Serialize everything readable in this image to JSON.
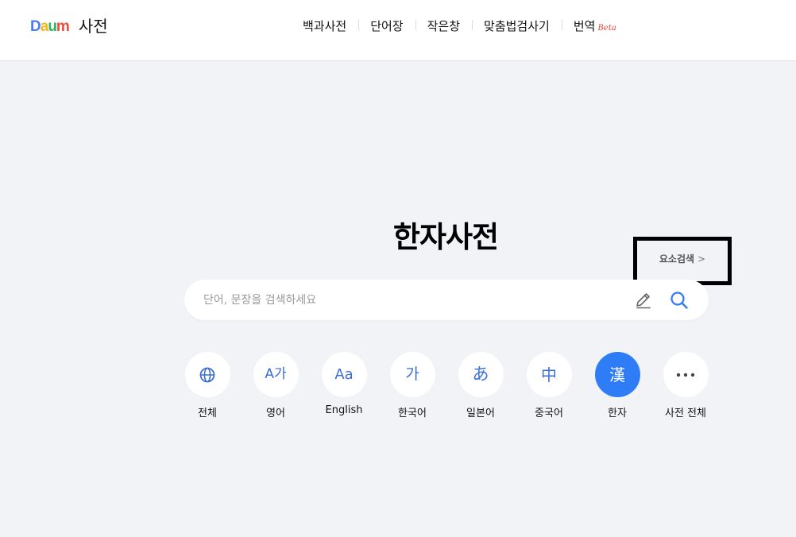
{
  "header": {
    "logo_letters": [
      "D",
      "a",
      "u",
      "m"
    ],
    "logo_colors": [
      "#4a7cf5",
      "#f2b81a",
      "#2fb35a",
      "#ec4a3b"
    ],
    "dict_title": "사전",
    "nav": [
      {
        "label": "백과사전"
      },
      {
        "label": "단어장"
      },
      {
        "label": "작은창"
      },
      {
        "label": "맞춤법검사기"
      },
      {
        "label": "번역",
        "badge": "Beta"
      }
    ]
  },
  "main": {
    "title": "한자사전",
    "element_search_label": "요소검색",
    "element_search_chevron": ">",
    "search": {
      "placeholder": "단어, 문장을 검색하세요",
      "value": ""
    },
    "categories": [
      {
        "label": "전체",
        "icon": "globe-icon",
        "glyph": ""
      },
      {
        "label": "영어",
        "icon": "english-korean-icon",
        "glyph": "A가"
      },
      {
        "label": "English",
        "icon": "english-icon",
        "glyph": "Aa"
      },
      {
        "label": "한국어",
        "icon": "korean-icon",
        "glyph": "가"
      },
      {
        "label": "일본어",
        "icon": "japanese-icon",
        "glyph": "あ"
      },
      {
        "label": "중국어",
        "icon": "chinese-icon",
        "glyph": "中"
      },
      {
        "label": "한자",
        "icon": "hanja-icon",
        "glyph": "漢",
        "active": true
      },
      {
        "label": "사전 전체",
        "icon": "more-icon",
        "glyph": "•••"
      }
    ]
  },
  "colors": {
    "accent": "#2f7df6",
    "icon_blue": "#3b6fd8",
    "background": "#f2f3f7",
    "beta_red": "#e8433a"
  }
}
